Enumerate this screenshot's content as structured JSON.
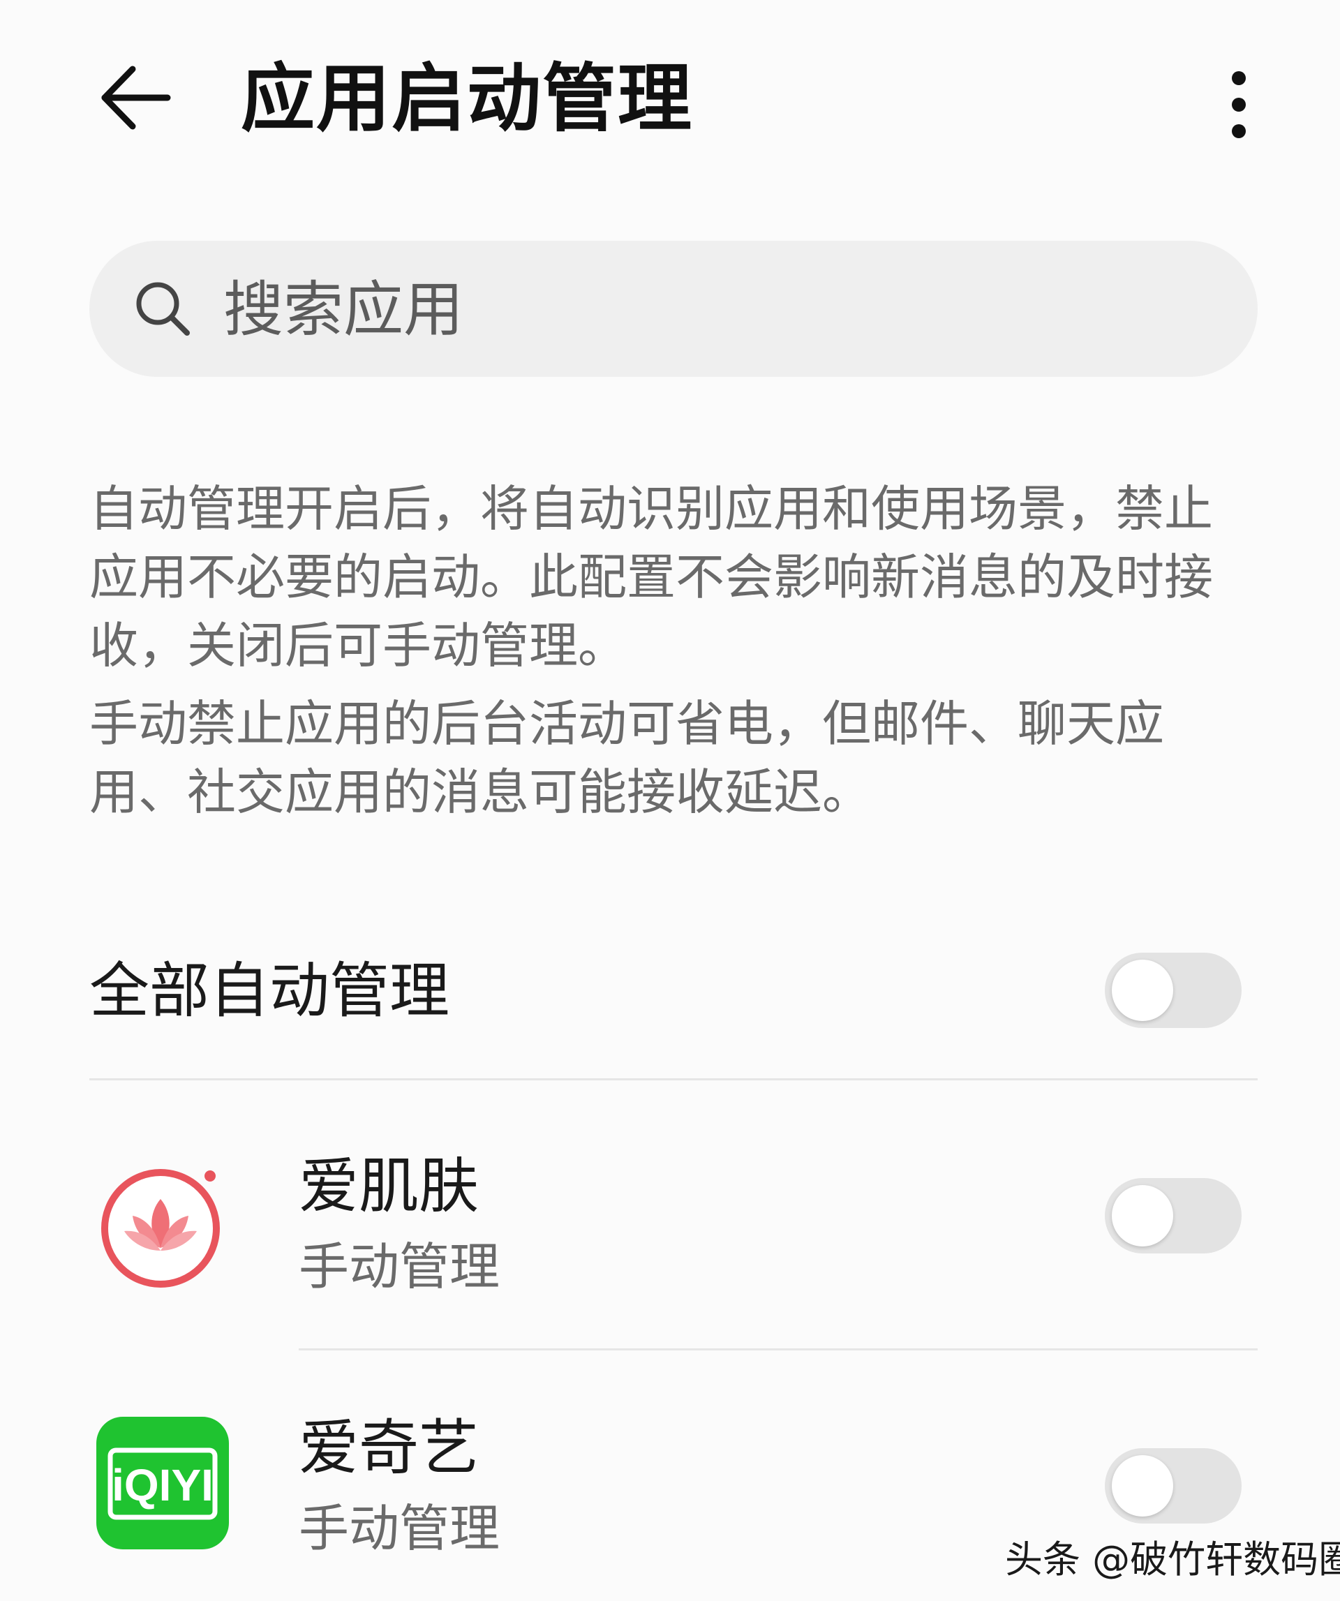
{
  "header": {
    "title": "应用启动管理"
  },
  "search": {
    "placeholder": "搜索应用",
    "value": ""
  },
  "description": {
    "para1": "自动管理开启后，将自动识别应用和使用场景，禁止应用不必要的启动。此配置不会影响新消息的及时接收，关闭后可手动管理。",
    "para2": "手动禁止应用的后台活动可省电，但邮件、聊天应用、社交应用的消息可能接收延迟。"
  },
  "manage_all": {
    "label": "全部自动管理",
    "enabled": false
  },
  "apps": [
    {
      "name": "爱肌肤",
      "status": "手动管理",
      "icon": "lotus-icon",
      "enabled": false
    },
    {
      "name": "爱奇艺",
      "status": "手动管理",
      "icon": "iqiyi-icon",
      "icon_text": "iQIYI",
      "enabled": false
    }
  ],
  "watermark": "头条 @破竹轩数码圈",
  "colors": {
    "toggle_off": "#e3e3e3",
    "iqiyi_green": "#1fc330",
    "lotus_red": "#e8545c"
  }
}
